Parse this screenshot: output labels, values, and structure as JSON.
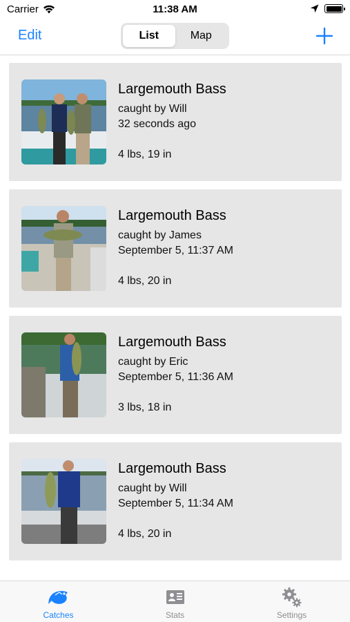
{
  "status_bar": {
    "carrier": "Carrier",
    "time": "11:38 AM",
    "battery_level": 1.0
  },
  "nav": {
    "edit_label": "Edit",
    "segments": [
      "List",
      "Map"
    ],
    "selected_segment": "List",
    "add_icon": "plus-icon"
  },
  "catches": [
    {
      "species": "Largemouth Bass",
      "caught_by": "caught by Will",
      "time": "32 seconds ago",
      "measure": "4 lbs, 19 in"
    },
    {
      "species": "Largemouth Bass",
      "caught_by": "caught by James",
      "time": "September 5, 11:37 AM",
      "measure": "4 lbs, 20 in"
    },
    {
      "species": "Largemouth Bass",
      "caught_by": "caught by Eric",
      "time": "September 5, 11:36 AM",
      "measure": "3 lbs, 18 in"
    },
    {
      "species": "Largemouth Bass",
      "caught_by": "caught by Will",
      "time": "September 5, 11:34 AM",
      "measure": "4 lbs, 20 in"
    }
  ],
  "tabs": [
    {
      "label": "Catches",
      "icon": "fish-icon",
      "active": true
    },
    {
      "label": "Stats",
      "icon": "stats-card-icon",
      "active": false
    },
    {
      "label": "Settings",
      "icon": "gears-icon",
      "active": false
    }
  ],
  "colors": {
    "accent": "#1a82ff",
    "card_bg": "#e6e6e6",
    "inactive_tab": "#8e8e93"
  }
}
